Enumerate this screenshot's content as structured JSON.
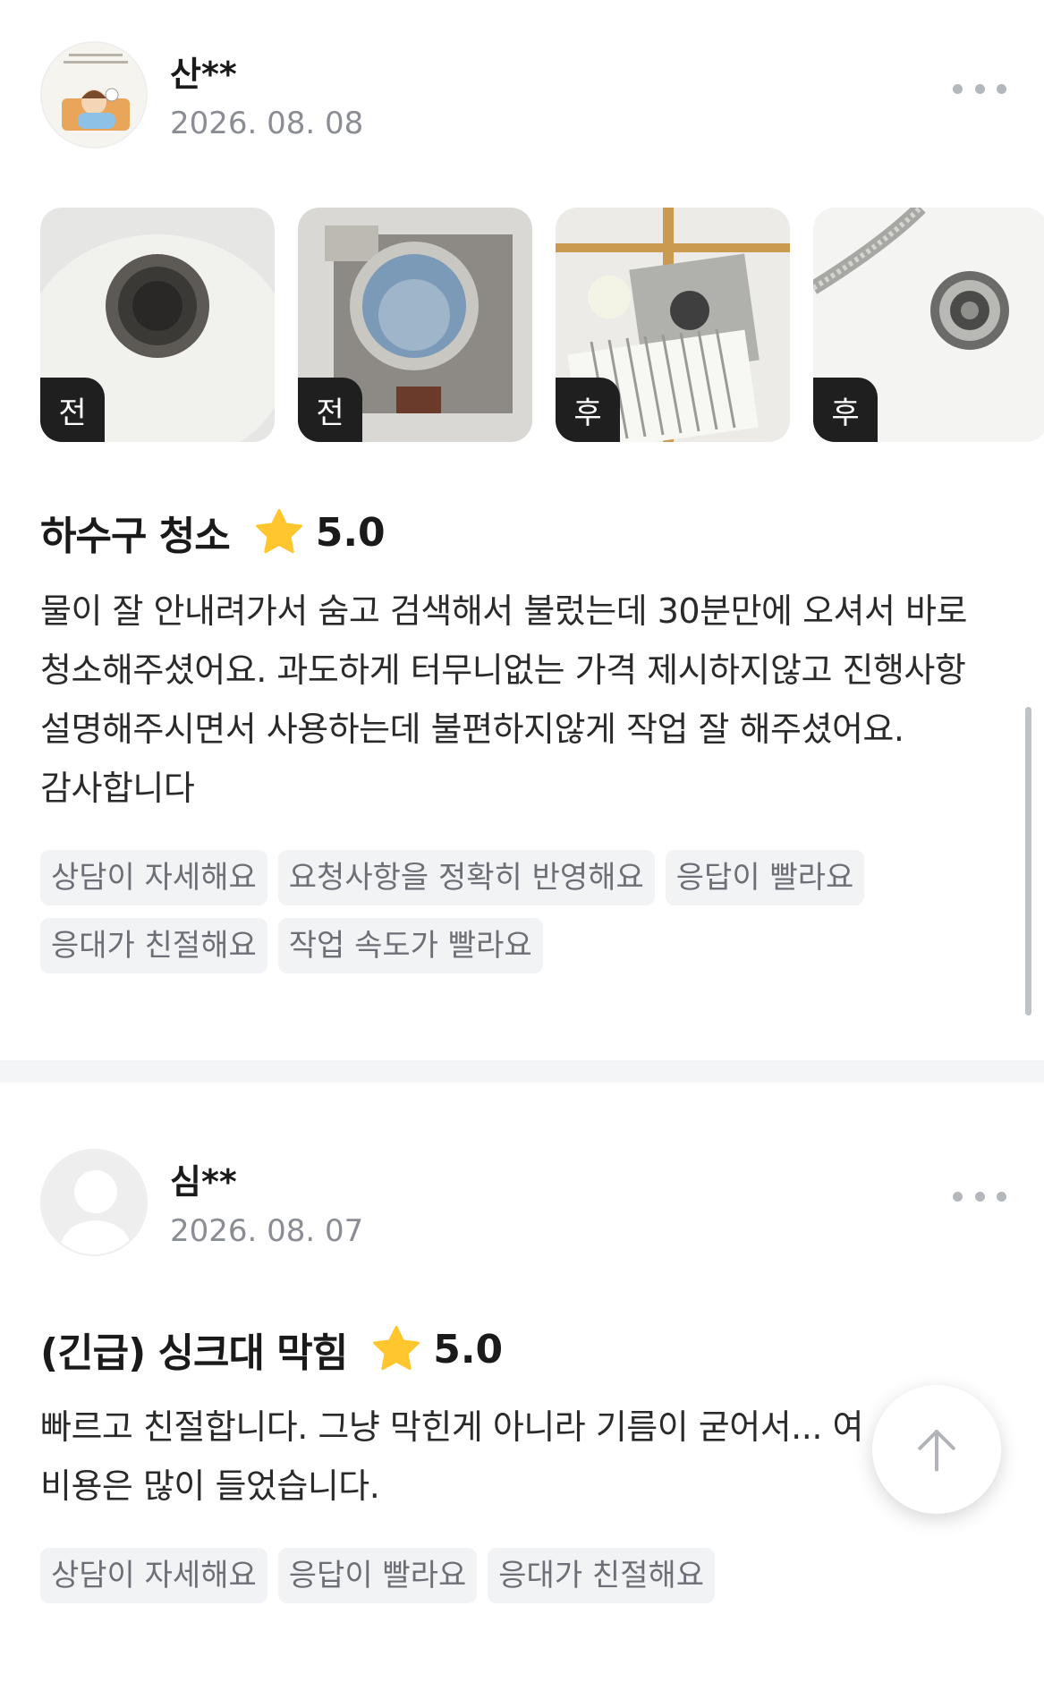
{
  "reviews": [
    {
      "user_name": "산**",
      "date": "2026. 08. 08",
      "avatar_icon": "cartoon-avatar-icon",
      "photos": [
        {
          "label": "전"
        },
        {
          "label": "전"
        },
        {
          "label": "후"
        },
        {
          "label": "후"
        }
      ],
      "title": "하수구 청소",
      "rating": "5.0",
      "text": "물이 잘 안내려가서 숨고 검색해서 불렀는데 30분만에 오셔서 바로 청소해주셨어요. 과도하게 터무니없는 가격 제시하지않고 진행사항 설명해주시면서 사용하는데 불편하지않게 작업 잘 해주셨어요. 감사합니다",
      "tags": [
        "상담이 자세해요",
        "요청사항을 정확히 반영해요",
        "응답이 빨라요",
        "응대가 친절해요",
        "작업 속도가 빨라요"
      ]
    },
    {
      "user_name": "심**",
      "date": "2026. 08. 07",
      "avatar_icon": "default-user-icon",
      "title": "(긴급) 싱크대 막힘",
      "rating": "5.0",
      "text_line1": "빠르고 친절합니다. 그냥 막힌게 아니라 기름이 굳어서... 여",
      "text_line2": "비용은 많이 들었습니다.",
      "tags": [
        "상담이 자세해요",
        "응답이 빨라요",
        "응대가 친절해요"
      ]
    }
  ],
  "colors": {
    "star": "#FFC62E",
    "tag_bg": "#F2F3F5",
    "tag_text": "#6C7076",
    "date_text": "#8A8D93"
  },
  "icons": {
    "more": "more-dots-icon",
    "star": "star-icon",
    "scroll_top": "arrow-up-icon"
  }
}
